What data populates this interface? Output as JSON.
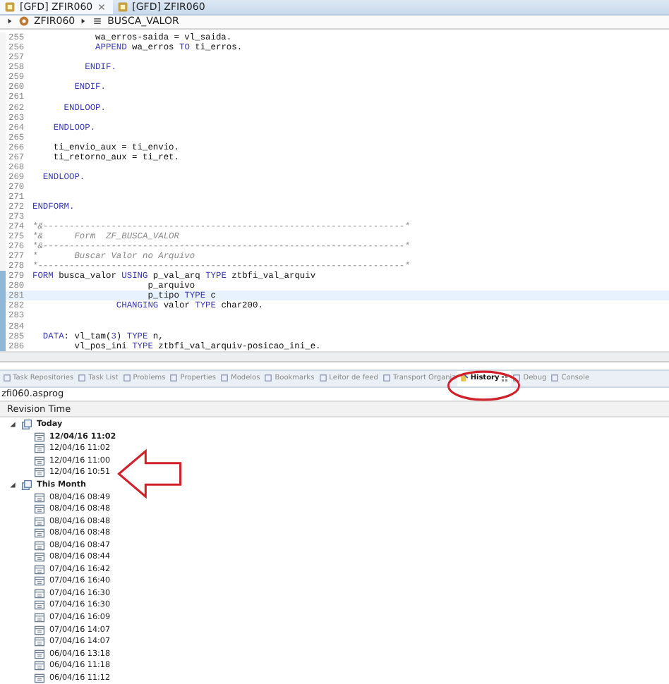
{
  "editor_tabs": [
    {
      "label": "[GFD] ZFIR060",
      "selected": true
    },
    {
      "label": "[GFD] ZFIR060",
      "selected": false
    }
  ],
  "breadcrumb": [
    "ZFIR060",
    "BUSCA_VALOR"
  ],
  "code_lines": [
    {
      "number": "255",
      "changed": false,
      "current": false,
      "segments": [
        {
          "kind": "plain",
          "text": "            wa_erros-saida = vl_saida."
        }
      ]
    },
    {
      "number": "256",
      "changed": false,
      "current": false,
      "segments": [
        {
          "kind": "kw",
          "text": "            APPEND"
        },
        {
          "kind": "plain",
          "text": " wa_erros "
        },
        {
          "kind": "kw",
          "text": "TO"
        },
        {
          "kind": "plain",
          "text": " ti_erros."
        }
      ]
    },
    {
      "number": "257",
      "changed": false,
      "current": false
    },
    {
      "number": "258",
      "changed": false,
      "current": false,
      "segments": [
        {
          "kind": "kw",
          "text": "          ENDIF."
        }
      ]
    },
    {
      "number": "259",
      "changed": false,
      "current": false
    },
    {
      "number": "260",
      "changed": false,
      "current": false,
      "segments": [
        {
          "kind": "kw",
          "text": "        ENDIF."
        }
      ]
    },
    {
      "number": "261",
      "changed": false,
      "current": false
    },
    {
      "number": "262",
      "changed": false,
      "current": false,
      "segments": [
        {
          "kind": "kw",
          "text": "      ENDLOOP."
        }
      ]
    },
    {
      "number": "263",
      "changed": false,
      "current": false
    },
    {
      "number": "264",
      "changed": false,
      "current": false,
      "segments": [
        {
          "kind": "kw",
          "text": "    ENDLOOP."
        }
      ]
    },
    {
      "number": "265",
      "changed": false,
      "current": false
    },
    {
      "number": "266",
      "changed": false,
      "current": false,
      "segments": [
        {
          "kind": "plain",
          "text": "    ti_envio_aux = ti_envio."
        }
      ]
    },
    {
      "number": "267",
      "changed": false,
      "current": false,
      "segments": [
        {
          "kind": "plain",
          "text": "    ti_retorno_aux = ti_ret."
        }
      ]
    },
    {
      "number": "268",
      "changed": false,
      "current": false
    },
    {
      "number": "269",
      "changed": false,
      "current": false,
      "segments": [
        {
          "kind": "kw",
          "text": "  ENDLOOP."
        }
      ]
    },
    {
      "number": "270",
      "changed": false,
      "current": false
    },
    {
      "number": "271",
      "changed": false,
      "current": false
    },
    {
      "number": "272",
      "changed": false,
      "current": false,
      "segments": [
        {
          "kind": "kw",
          "text": "ENDFORM."
        }
      ]
    },
    {
      "number": "273",
      "changed": false,
      "current": false
    },
    {
      "number": "274",
      "changed": false,
      "current": false,
      "segments": [
        {
          "kind": "comment",
          "text": "*&---------------------------------------------------------------------*"
        }
      ]
    },
    {
      "number": "275",
      "changed": false,
      "current": false,
      "segments": [
        {
          "kind": "comment",
          "text": "*&      Form  ZF_BUSCA_VALOR"
        }
      ]
    },
    {
      "number": "276",
      "changed": false,
      "current": false,
      "segments": [
        {
          "kind": "comment",
          "text": "*&---------------------------------------------------------------------*"
        }
      ]
    },
    {
      "number": "277",
      "changed": false,
      "current": false,
      "segments": [
        {
          "kind": "comment",
          "text": "*       Buscar Valor no Arquivo"
        }
      ]
    },
    {
      "number": "278",
      "changed": false,
      "current": false,
      "segments": [
        {
          "kind": "comment",
          "text": "*----------------------------------------------------------------------*"
        }
      ]
    },
    {
      "number": "279",
      "changed": true,
      "current": false,
      "segments": [
        {
          "kind": "kw",
          "text": "FORM"
        },
        {
          "kind": "plain",
          "text": " busca_valor "
        },
        {
          "kind": "kw",
          "text": "USING"
        },
        {
          "kind": "plain",
          "text": " p_val_arq "
        },
        {
          "kind": "kw",
          "text": "TYPE"
        },
        {
          "kind": "plain",
          "text": " ztbfi_val_arquiv"
        }
      ]
    },
    {
      "number": "280",
      "changed": true,
      "current": false,
      "segments": [
        {
          "kind": "plain",
          "text": "                      p_arquivo"
        }
      ]
    },
    {
      "number": "281",
      "changed": true,
      "current": true,
      "segments": [
        {
          "kind": "plain",
          "text": "                      p_tipo "
        },
        {
          "kind": "kw",
          "text": "TYPE"
        },
        {
          "kind": "plain",
          "text": " c"
        }
      ]
    },
    {
      "number": "282",
      "changed": true,
      "current": false,
      "segments": [
        {
          "kind": "kw",
          "text": "                CHANGING"
        },
        {
          "kind": "plain",
          "text": " valor "
        },
        {
          "kind": "kw",
          "text": "TYPE"
        },
        {
          "kind": "plain",
          "text": " char200."
        }
      ]
    },
    {
      "number": "283",
      "changed": true,
      "current": false
    },
    {
      "number": "284",
      "changed": true,
      "current": false
    },
    {
      "number": "285",
      "changed": true,
      "current": false,
      "segments": [
        {
          "kind": "kw",
          "text": "  DATA"
        },
        {
          "kind": "plain",
          "text": ": vl_tam("
        },
        {
          "kind": "num",
          "text": "3"
        },
        {
          "kind": "plain",
          "text": ") "
        },
        {
          "kind": "kw",
          "text": "TYPE"
        },
        {
          "kind": "plain",
          "text": " n,"
        }
      ]
    },
    {
      "number": "286",
      "changed": true,
      "current": false,
      "segments": [
        {
          "kind": "plain",
          "text": "        vl_pos_ini "
        },
        {
          "kind": "kw",
          "text": "TYPE"
        },
        {
          "kind": "plain",
          "text": " ztbfi_val_arquiv-posicao_ini_e."
        }
      ]
    }
  ],
  "view_tabs": [
    {
      "label": "Task Repositories",
      "selected": false
    },
    {
      "label": "Task List",
      "selected": false
    },
    {
      "label": "Problems",
      "selected": false
    },
    {
      "label": "Properties",
      "selected": false
    },
    {
      "label": "Modelos",
      "selected": false
    },
    {
      "label": "Bookmarks",
      "selected": false
    },
    {
      "label": "Leitor de feed",
      "selected": false
    },
    {
      "label": "Transport Organiz",
      "selected": false
    },
    {
      "label": "History",
      "selected": true
    },
    {
      "label": "Debug",
      "selected": false
    },
    {
      "label": "Console",
      "selected": false
    }
  ],
  "history": {
    "resource": "zfi060.asprog",
    "column": "Revision Time",
    "groups": [
      {
        "label": "Today",
        "expanded": true,
        "children": [
          {
            "label": "12/04/16 11:02",
            "bold": true
          },
          {
            "label": "12/04/16 11:02",
            "bold": false
          },
          {
            "label": "12/04/16 11:00",
            "bold": false
          },
          {
            "label": "12/04/16 10:51",
            "bold": false
          }
        ]
      },
      {
        "label": "This Month",
        "expanded": true,
        "children": [
          {
            "label": "08/04/16 08:49",
            "bold": false
          },
          {
            "label": "08/04/16 08:48",
            "bold": false
          },
          {
            "label": "08/04/16 08:48",
            "bold": false
          },
          {
            "label": "08/04/16 08:48",
            "bold": false
          },
          {
            "label": "08/04/16 08:47",
            "bold": false
          },
          {
            "label": "08/04/16 08:44",
            "bold": false
          },
          {
            "label": "07/04/16 16:42",
            "bold": false
          },
          {
            "label": "07/04/16 16:40",
            "bold": false
          },
          {
            "label": "07/04/16 16:30",
            "bold": false
          },
          {
            "label": "07/04/16 16:30",
            "bold": false
          },
          {
            "label": "07/04/16 16:09",
            "bold": false
          },
          {
            "label": "07/04/16 14:07",
            "bold": false
          },
          {
            "label": "07/04/16 14:07",
            "bold": false
          },
          {
            "label": "06/04/16 13:18",
            "bold": false
          },
          {
            "label": "06/04/16 11:18",
            "bold": false
          },
          {
            "label": "06/04/16 11:12",
            "bold": false
          }
        ]
      }
    ]
  }
}
